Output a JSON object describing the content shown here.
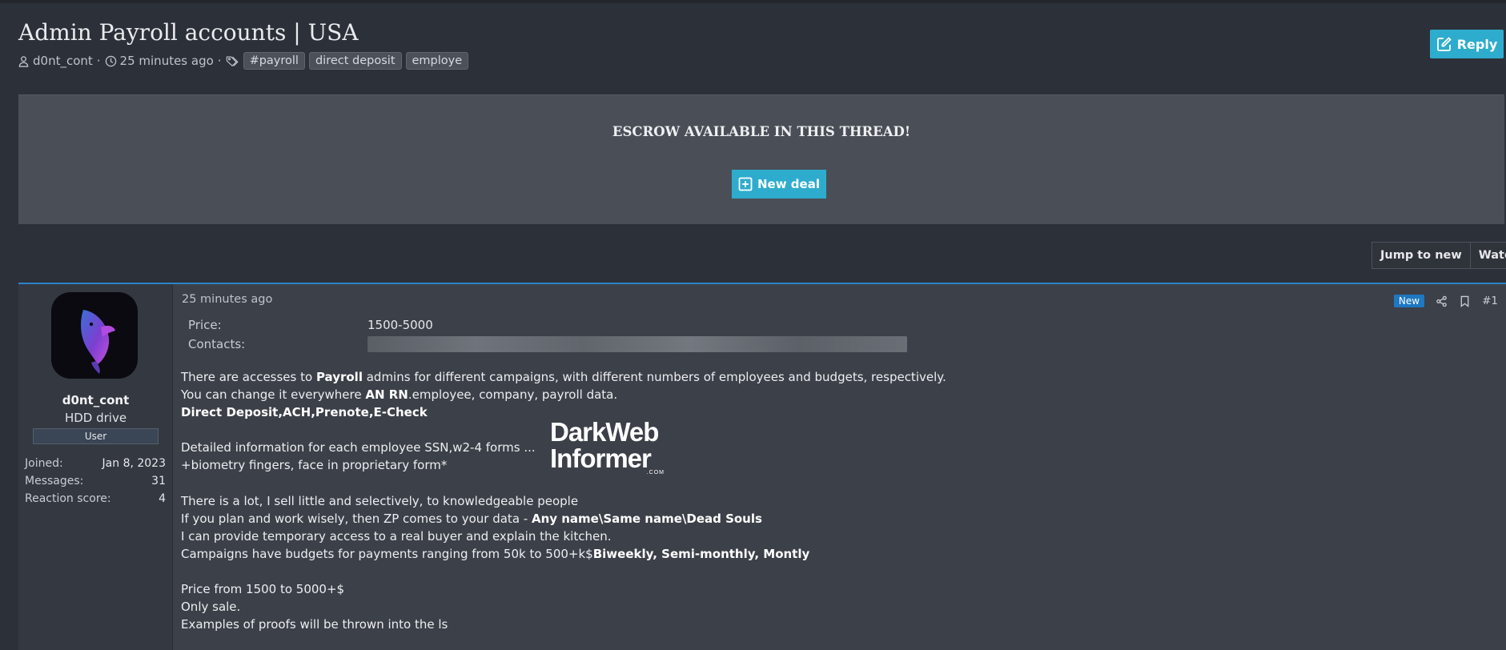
{
  "thread": {
    "title": "Admin Payroll accounts | USA",
    "author": "d0nt_cont",
    "time": "25 minutes ago",
    "tags": [
      "#payroll",
      "direct deposit",
      "employe"
    ],
    "reply_label": "Reply"
  },
  "escrow": {
    "notice": "ESCROW AVAILABLE IN THIS THREAD!",
    "new_deal_label": "New deal"
  },
  "thread_actions": {
    "jump_label": "Jump to new",
    "watch_label": "Watch"
  },
  "post": {
    "date": "25 minutes ago",
    "badge": "New",
    "number": "#1",
    "fields": {
      "price_label": "Price:",
      "price_value": "1500-5000",
      "contacts_label": "Contacts:"
    },
    "lines": {
      "l1a": "There are accesses to ",
      "l1b": "Payroll",
      "l1c": " admins for different campaigns, with different numbers of employees and budgets, respectively.",
      "l2a": "You can change it everywhere ",
      "l2b": "AN RN",
      "l2c": ".employee, company, payroll data.",
      "l3": "Direct Deposit,ACH,Prenote,E-Check",
      "l4": "Detailed information for each employee SSN,w2-4 forms ...",
      "l5": "+biometry fingers, face in proprietary form*",
      "l6": "There is a lot, I sell little and selectively, to knowledgeable people",
      "l7a": "If you plan and work wisely, then ZP comes to your data - ",
      "l7b": "Any name\\Same name\\Dead Souls",
      "l8": "I can provide temporary access to a real buyer and explain the kitchen.",
      "l9a": "Campaigns have budgets for payments ranging from 50k to 500+k$",
      "l9b": "Biweekly, Semi-monthly, Montly",
      "l10": "Price from 1500 to 5000+$",
      "l11": "Only sale.",
      "l12": "Examples of proofs will be thrown into the ls"
    }
  },
  "user": {
    "name": "d0nt_cont",
    "title": "HDD drive",
    "banner": "User",
    "joined_label": "Joined:",
    "joined_value": "Jan 8, 2023",
    "messages_label": "Messages:",
    "messages_value": "31",
    "reaction_label": "Reaction score:",
    "reaction_value": "4"
  },
  "watermark": {
    "line1": "DarkWeb",
    "line2": "Informer",
    "line3": ".COM"
  },
  "colors": {
    "accent": "#2eaccd",
    "post_border": "#2b83c8",
    "badge_new": "#1e78c2"
  }
}
